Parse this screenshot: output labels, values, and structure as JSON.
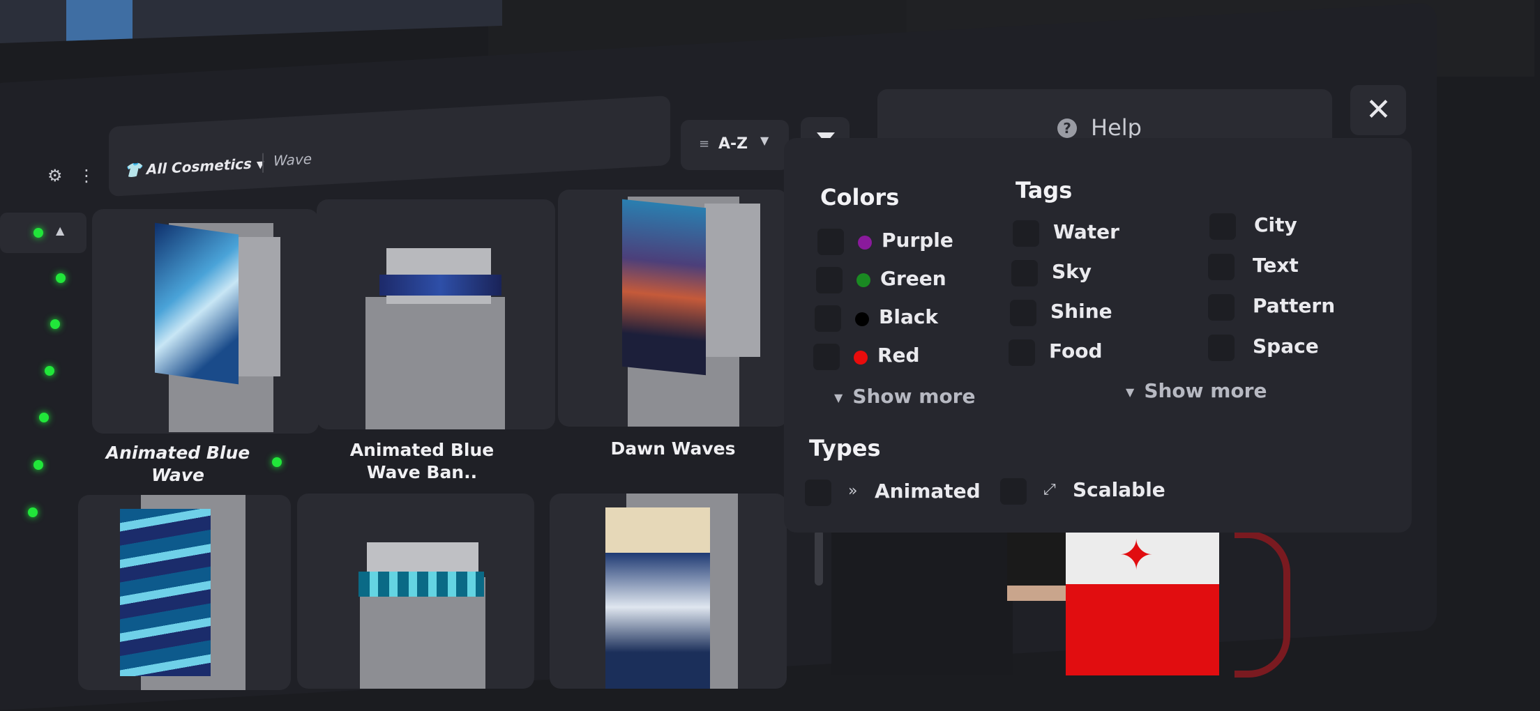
{
  "topbar": {
    "label": ""
  },
  "search": {
    "category_label": "All Cosmetics",
    "query": "Wave"
  },
  "sort": {
    "label": "A-Z"
  },
  "help": {
    "label": "Help"
  },
  "close": {
    "label": "✕"
  },
  "cosmetics": [
    {
      "name": "Animated Blue Wave",
      "line1": "Animated Blue",
      "line2": "Wave",
      "equipped": true
    },
    {
      "name": "Animated Blue Wave Ban..",
      "line1": "Animated Blue",
      "line2": "Wave Ban..",
      "equipped": false
    },
    {
      "name": "Dawn Waves",
      "line1": "Dawn Waves",
      "line2": "",
      "equipped": false
    }
  ],
  "filters": {
    "colors_heading": "Colors",
    "colors": [
      {
        "label": "Purple",
        "color": "#8a1a9c"
      },
      {
        "label": "Green",
        "color": "#1a8a22"
      },
      {
        "label": "Black",
        "color": "#000000"
      },
      {
        "label": "Red",
        "color": "#e80c0c"
      }
    ],
    "colors_more": "Show more",
    "tags_heading": "Tags",
    "tags_col1": [
      "Water",
      "Sky",
      "Shine",
      "Food"
    ],
    "tags_col2": [
      "City",
      "Text",
      "Pattern",
      "Space"
    ],
    "tags_more": "Show more",
    "types_heading": "Types",
    "types": [
      {
        "label": "Animated",
        "icon": "fast-forward-icon"
      },
      {
        "label": "Scalable",
        "icon": "resize-icon"
      }
    ]
  }
}
